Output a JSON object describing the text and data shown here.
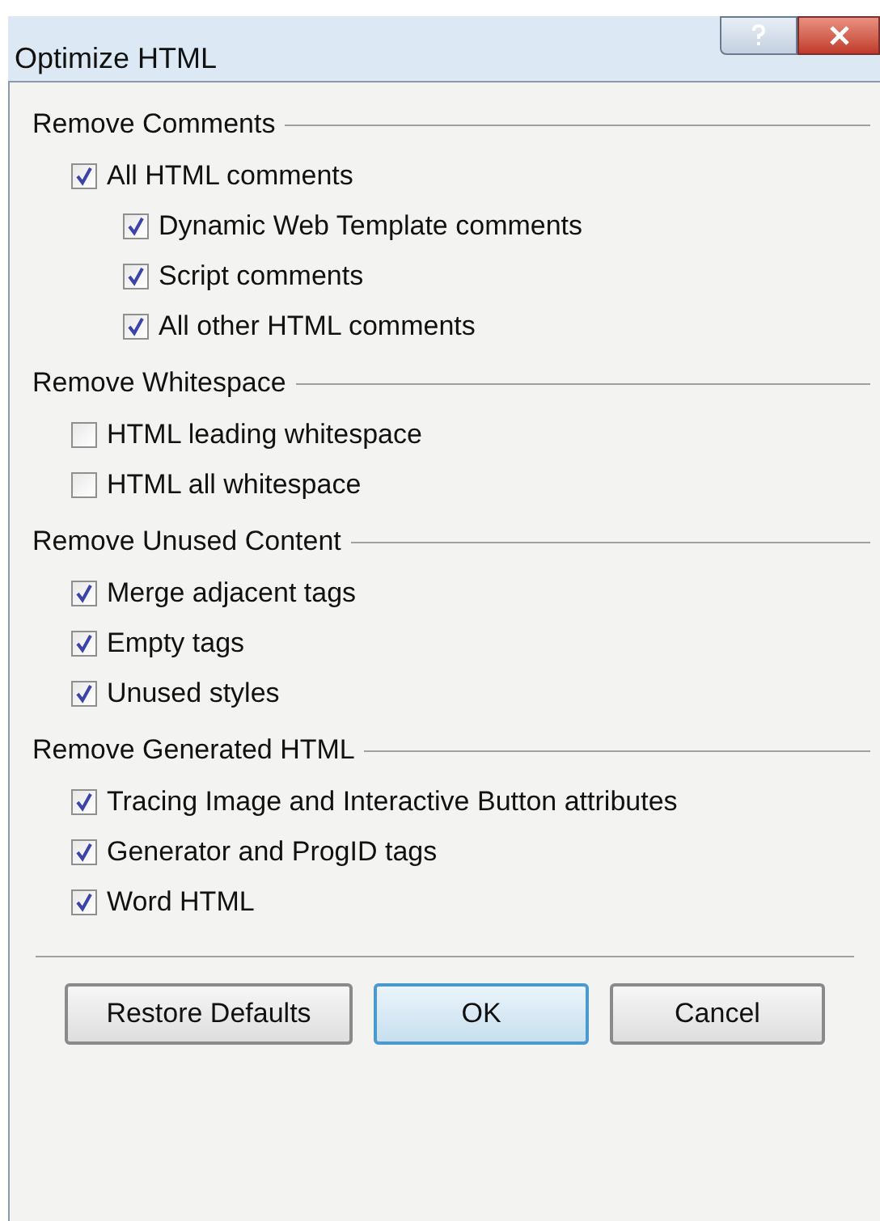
{
  "window": {
    "title": "Optimize HTML"
  },
  "sections": [
    {
      "title": "Remove Comments",
      "options": [
        {
          "label": "All HTML comments",
          "checked": true,
          "children": [
            {
              "label": "Dynamic Web Template comments",
              "checked": true
            },
            {
              "label": "Script comments",
              "checked": true
            },
            {
              "label": "All other HTML comments",
              "checked": true
            }
          ]
        }
      ]
    },
    {
      "title": "Remove Whitespace",
      "options": [
        {
          "label": "HTML leading whitespace",
          "checked": false
        },
        {
          "label": "HTML all whitespace",
          "checked": false
        }
      ]
    },
    {
      "title": "Remove Unused Content",
      "options": [
        {
          "label": "Merge adjacent tags",
          "checked": true
        },
        {
          "label": "Empty tags",
          "checked": true
        },
        {
          "label": "Unused styles",
          "checked": true
        }
      ]
    },
    {
      "title": "Remove Generated HTML",
      "options": [
        {
          "label": "Tracing Image and Interactive Button attributes",
          "checked": true
        },
        {
          "label": "Generator and ProgID tags",
          "checked": true
        },
        {
          "label": "Word HTML",
          "checked": true
        }
      ]
    }
  ],
  "buttons": [
    {
      "label": "Restore Defaults",
      "selected": false
    },
    {
      "label": "OK",
      "selected": true
    },
    {
      "label": "Cancel",
      "selected": false
    }
  ]
}
